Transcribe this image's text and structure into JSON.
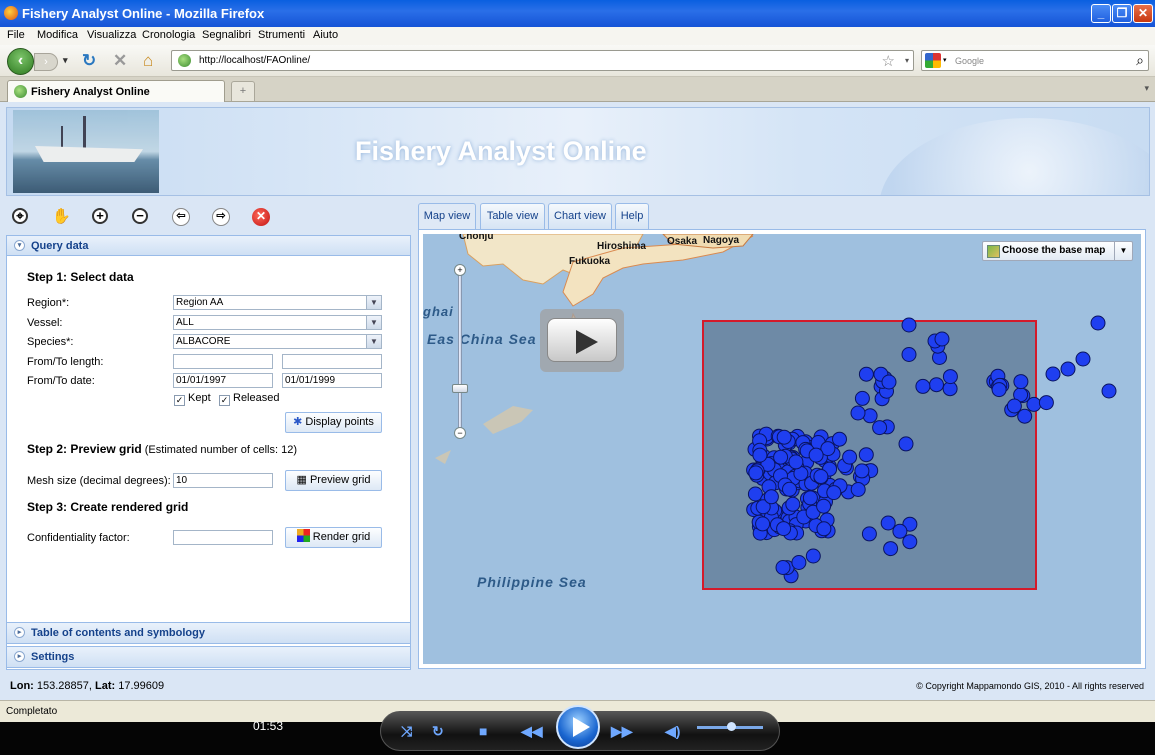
{
  "window": {
    "title": "Fishery Analyst Online - Mozilla Firefox"
  },
  "menu": [
    "File",
    "Modifica",
    "Visualizza",
    "Cronologia",
    "Segnalibri",
    "Strumenti",
    "Aiuto"
  ],
  "nav": {
    "url": "http://localhost/FAOnline/",
    "search_placeholder": "Google"
  },
  "browser_tab": {
    "label": "Fishery Analyst Online",
    "new_tab": "+"
  },
  "banner": {
    "title": "Fishery Analyst Online"
  },
  "query": {
    "header": "Query data",
    "step1": "Step 1: Select data",
    "region_label": "Region*:",
    "region_value": "Region AA",
    "vessel_label": "Vessel:",
    "vessel_value": "ALL",
    "species_label": "Species*:",
    "species_value": "ALBACORE",
    "length_label": "From/To length:",
    "date_label": "From/To date:",
    "date_from": "01/01/1997",
    "date_to": "01/01/1999",
    "kept_label": "Kept",
    "released_label": "Released",
    "display_points": "Display points",
    "step2": "Step 2: Preview grid",
    "step2_note": "(Estimated number of cells: 12)",
    "mesh_label": "Mesh size (decimal degrees):",
    "mesh_value": "10",
    "preview_grid": "Preview grid",
    "step3": "Step 3: Create rendered grid",
    "conf_label": "Confidentiality factor:",
    "render_grid": "Render grid"
  },
  "panels": {
    "toc": "Table of contents and symbology",
    "settings": "Settings"
  },
  "map_tabs": [
    "Map view",
    "Table view",
    "Chart view",
    "Help"
  ],
  "map": {
    "base_map": "Choose the base map",
    "labels": {
      "hiroshima": "Hiroshima",
      "osaka": "Osaka",
      "nagoya": "Nagoya",
      "fukuoka": "Fukuoka",
      "chonju": "Chonju",
      "hai": "ghai"
    },
    "seas": {
      "east_china": "Eas  China Sea",
      "philippine": "Philippine Sea"
    }
  },
  "status": {
    "coords": "Lon: 153.28857, Lat: 17.99609",
    "lon_label": "Lon:",
    "lon": "153.28857",
    "lat_label": "Lat:",
    "lat": "17.99609",
    "copyright": "© Copyright Mappamondo GIS, 2010 - All rights reserved"
  },
  "firefox_status": "Completato",
  "player": {
    "time": "01:53"
  },
  "colors": {
    "points": "#1f3ff0",
    "bbox": "#d41a2a",
    "panel_header": "#15428b"
  }
}
